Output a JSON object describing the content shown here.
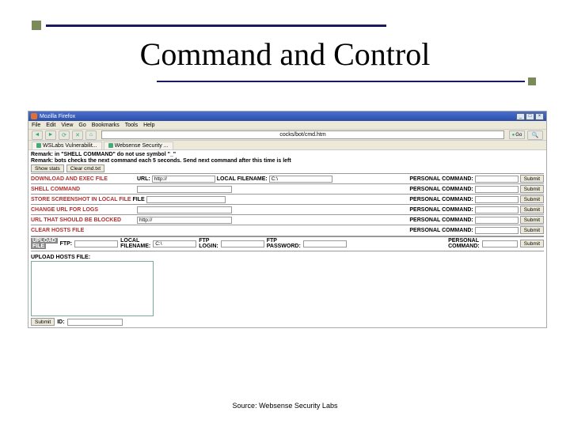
{
  "slide": {
    "title": "Command and Control",
    "source": "Source: Websense Security Labs"
  },
  "browser": {
    "app": "Mozilla Firefox",
    "menu": [
      "File",
      "Edit",
      "View",
      "Go",
      "Bookmarks",
      "Tools",
      "Help"
    ],
    "address": "cocks/bot/cmd.htm",
    "go": "Go",
    "tabs": [
      "WSLabs Vulnerabilit...",
      "Websense Security ..."
    ]
  },
  "page": {
    "remark1": "Remark: in \"SHELL COMMAND\" do not use symbol \"_\"",
    "remark2": "Remark: bots checks the next command each 5 seconds. Send next command after this time is left",
    "btn_showstats": "Show stats",
    "btn_clearcmd": "Clear cmd.txt",
    "submit": "Submit",
    "rows": {
      "dl": "DOWNLOAD AND EXEC FILE",
      "shell": "SHELL COMMAND",
      "store": "STORE SCREENSHOT IN LOCAL FILE",
      "chlog": "CHANGE URL FOR LOGS",
      "block": "URL THAT SHOULD BE BLOCKED",
      "clearhosts": "CLEAR HOSTS FILE"
    },
    "labels": {
      "url": "URL:",
      "file": "FILE",
      "localfilename": "LOCAL FILENAME:",
      "personalcmd": "PERSONAL COMMAND:",
      "upload": "UPLOAD",
      "uploadfile": "FILE",
      "ftp": "FTP:",
      "local_filename_stack": "LOCAL\nFILENAME:",
      "ftp_login_stack": "FTP\nLOGIN:",
      "ftp_pass_stack": "FTP\nPASSWORD:",
      "hosts": "UPLOAD HOSTS FILE:",
      "id": "ID:"
    },
    "values": {
      "url_http": "http://",
      "cdrive": "C:\\"
    }
  }
}
